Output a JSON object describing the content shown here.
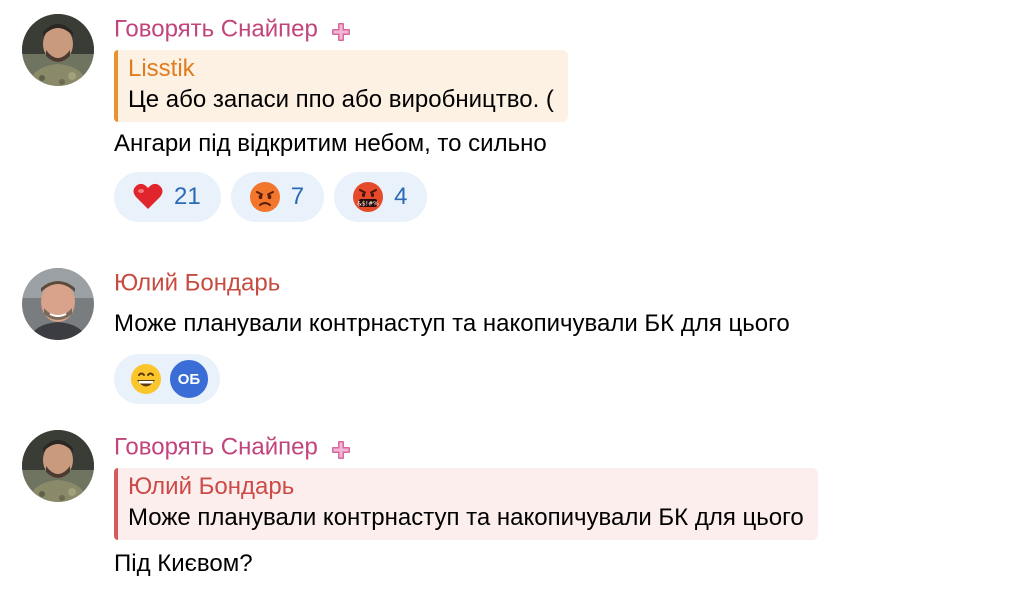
{
  "colors": {
    "author_pink": "#c2447d",
    "author_red": "#c84b3f",
    "reply_orange_name": "#e07c1e",
    "reply_red_name": "#cc4a47",
    "reaction_text": "#2b6ab6",
    "reaction_bg": "#e9f1fb"
  },
  "messages": [
    {
      "author": "Говорять Снайпер",
      "author_badge_icon": "plus-badge-icon",
      "reply": {
        "name": "Lisstik",
        "text": "Це або запаси ппо або виробництво. ("
      },
      "text": "Ангари під відкритим небом, то сильно",
      "reactions": [
        {
          "emoji": "red-heart-icon",
          "count": "21"
        },
        {
          "emoji": "angry-face-icon",
          "count": "7"
        },
        {
          "emoji": "cursing-face-icon",
          "count": "4"
        }
      ]
    },
    {
      "author": "Юлий Бондарь",
      "text": "Може планували контрнаступ та накопичували БК для цього",
      "reactions": [
        {
          "emoji": "grinning-face-icon",
          "reactor_initials": "ОБ"
        }
      ]
    },
    {
      "author": "Говорять Снайпер",
      "author_badge_icon": "plus-badge-icon",
      "reply": {
        "name": "Юлий Бондарь",
        "text": "Може планували контрнаступ та накопичували БК для цього"
      },
      "text": "Під Києвом?"
    }
  ]
}
